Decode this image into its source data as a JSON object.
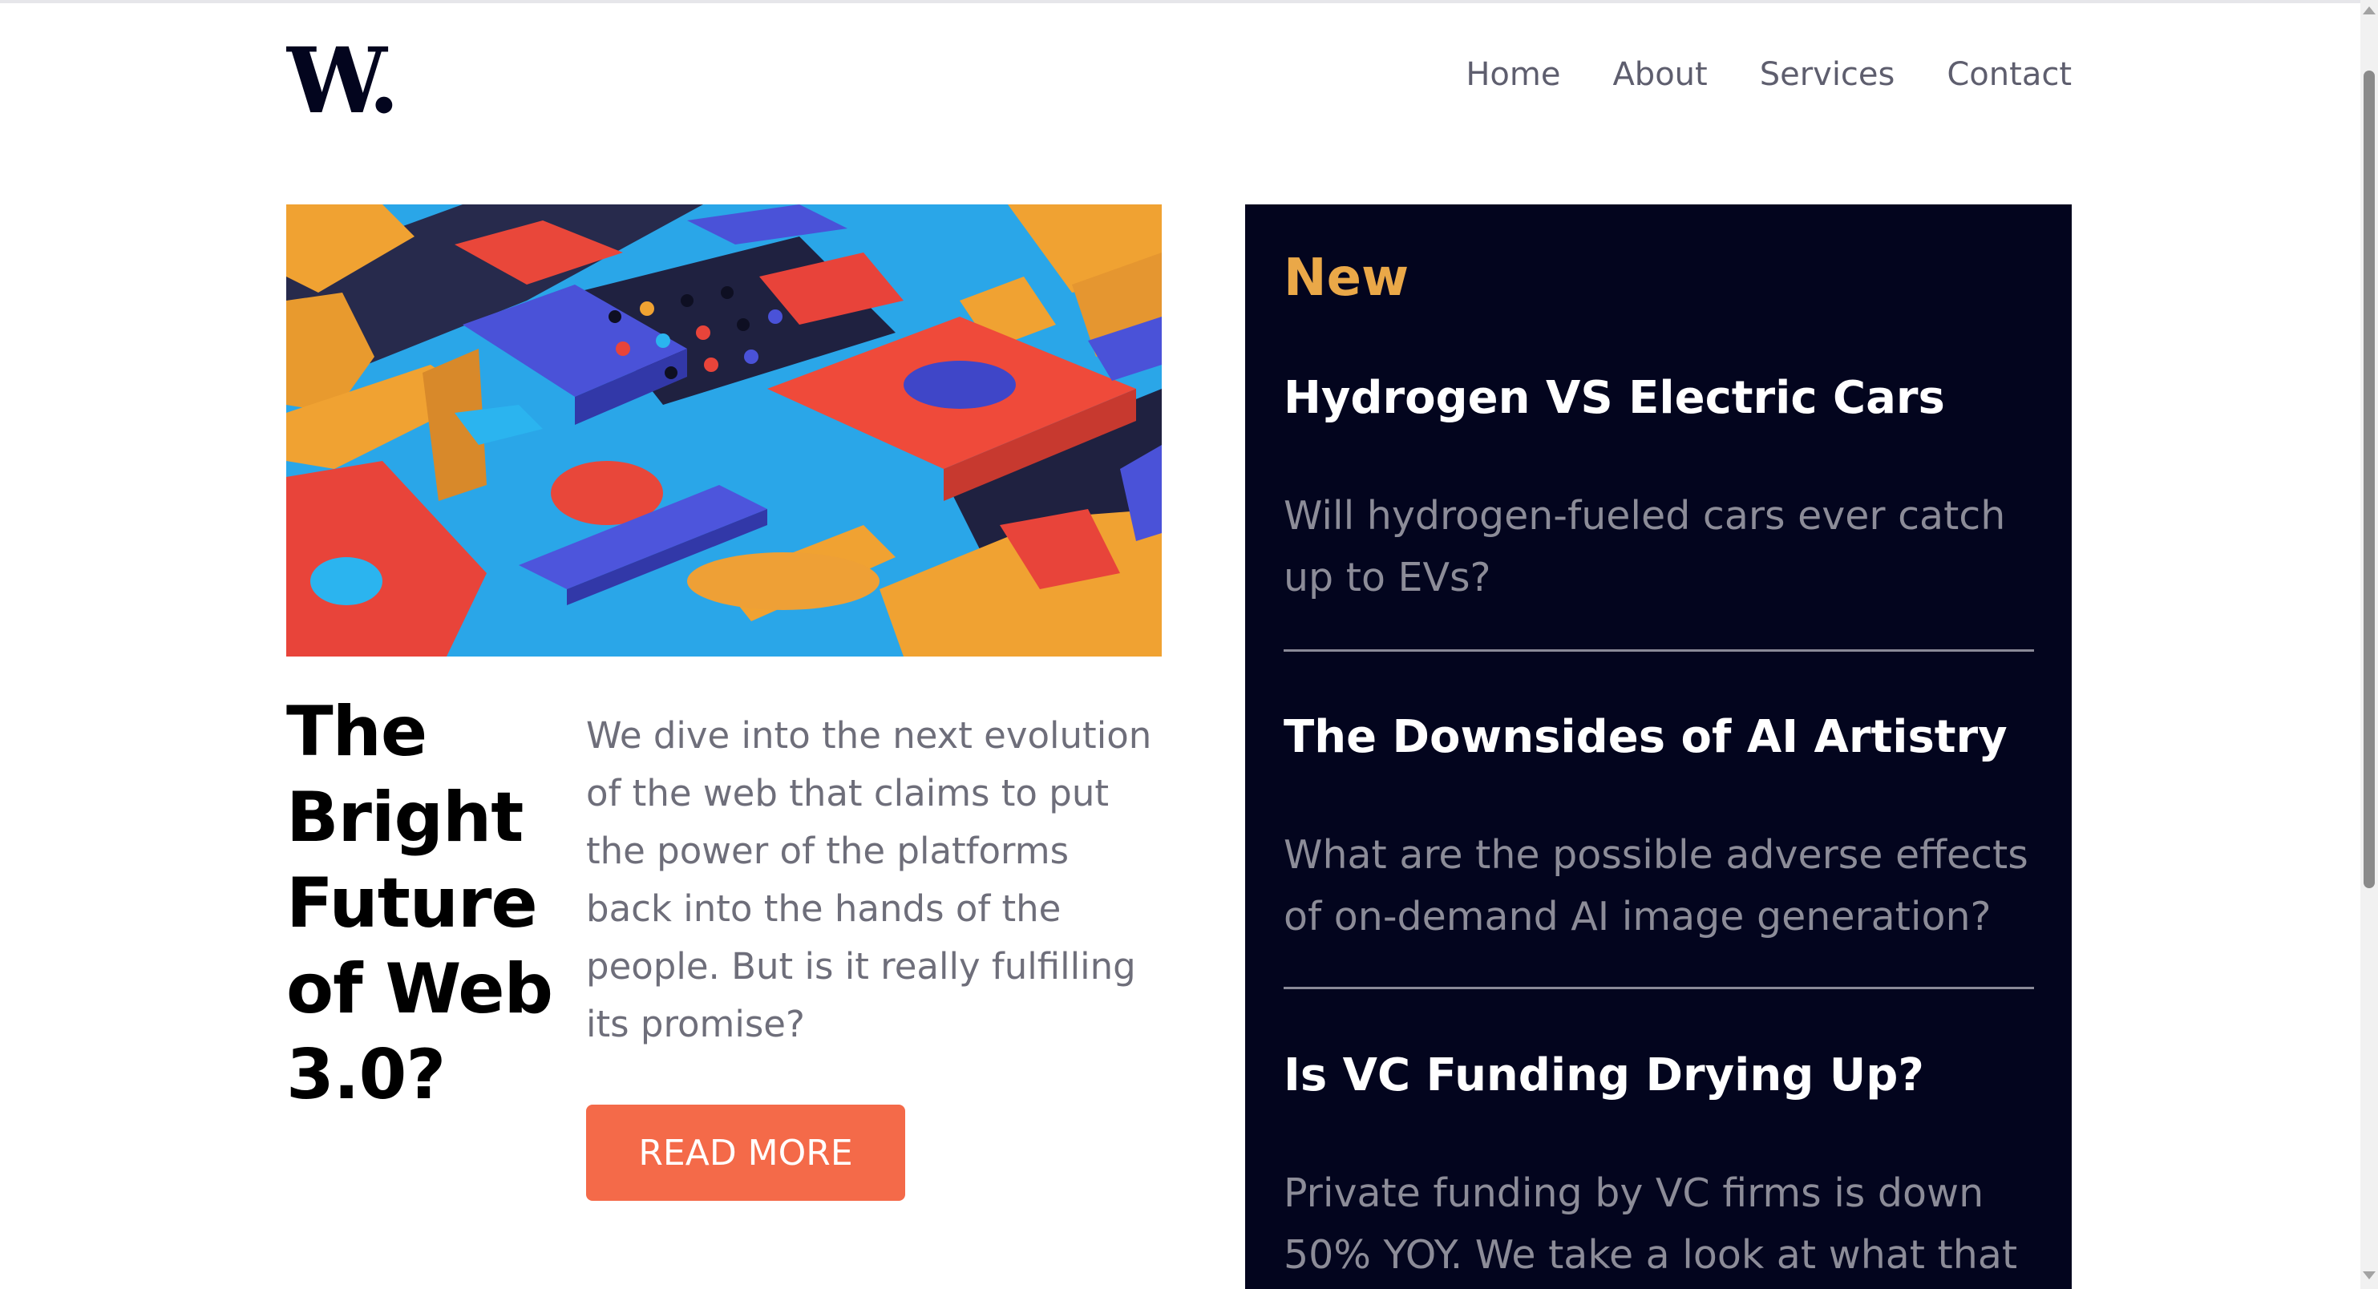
{
  "header": {
    "logo_text": "W.",
    "nav": [
      {
        "label": "Home"
      },
      {
        "label": "About"
      },
      {
        "label": "Services"
      },
      {
        "label": "Contact"
      }
    ]
  },
  "main_article": {
    "image_alt": "3D abstract composition of colorful geometric blocks",
    "title": "The Bright Future of Web 3.0?",
    "description": "We dive into the next evolution of the web that claims to put the power of the platforms back into the hands of the people. But is it really fulfilling its promise?",
    "button_label": "READ MORE"
  },
  "sidebar": {
    "heading": "New",
    "items": [
      {
        "title": "Hydrogen VS Electric Cars",
        "text": "Will hydrogen-fueled cars ever catch up to EVs?"
      },
      {
        "title": "The Downsides of AI Artistry",
        "text": "What are the possible adverse effects of on-demand AI image generation?"
      },
      {
        "title": "Is VC Funding Drying Up?",
        "text": "Private funding by VC firms is down 50% YOY. We take a look at what that"
      }
    ]
  },
  "colors": {
    "accent_orange": "#f46a49",
    "sidebar_bg": "#03051e",
    "sidebar_heading": "#eaa848",
    "body_text": "#6e6e7a"
  }
}
